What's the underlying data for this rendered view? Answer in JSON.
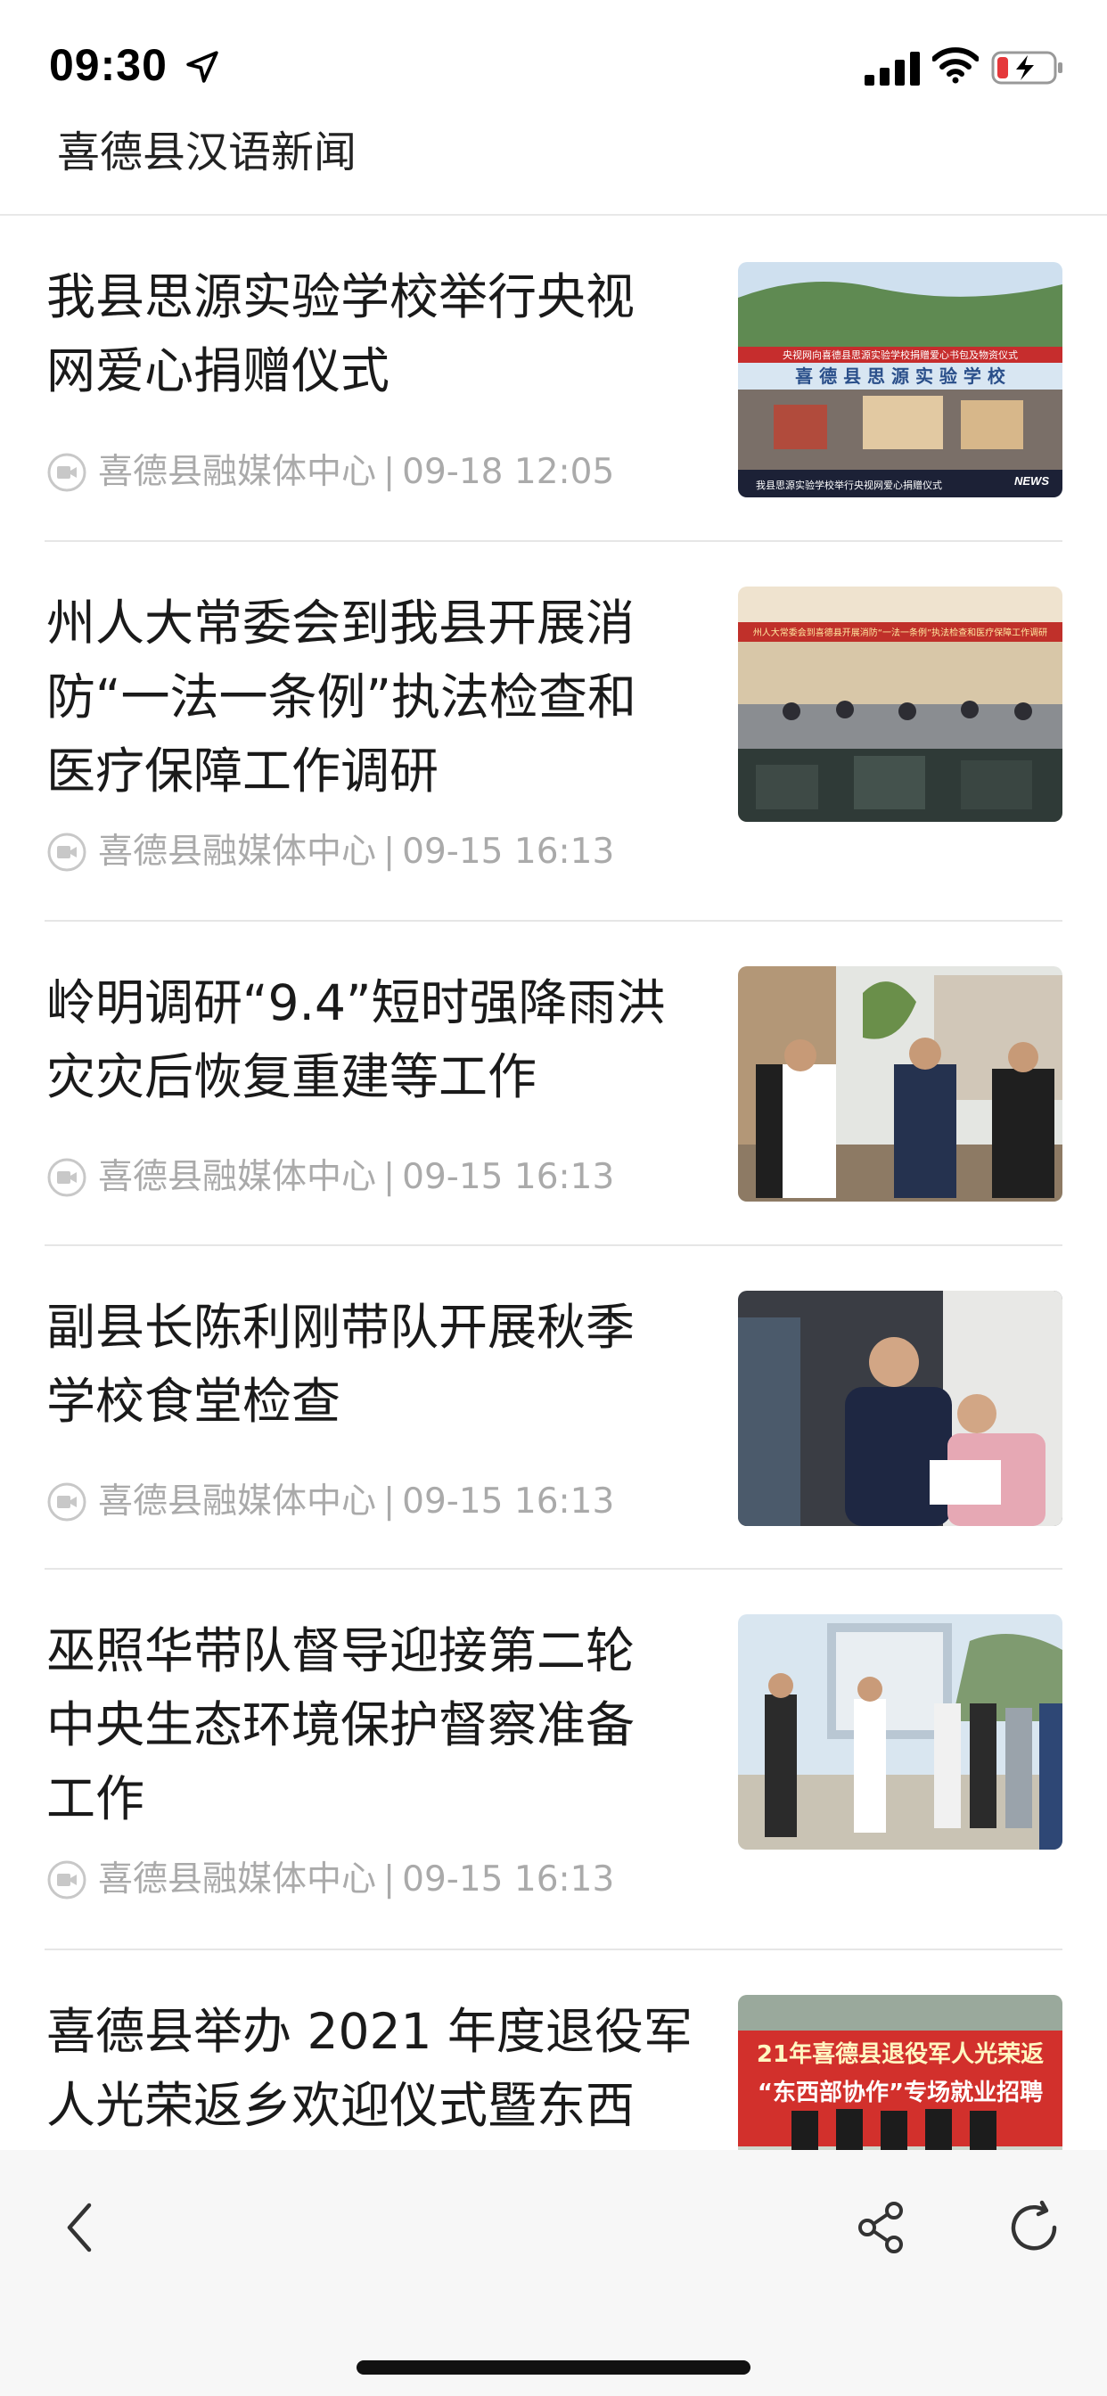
{
  "status_bar": {
    "time": "09:30",
    "icons": [
      "location-arrow-icon",
      "cellular-signal-icon",
      "wifi-icon",
      "battery-charging-icon"
    ],
    "battery_color": "#e5383b"
  },
  "header": {
    "title": "喜德县汉语新闻"
  },
  "news": [
    {
      "title_lines": [
        "我县思源实验学校举行央视",
        "网爱心捐赠仪式"
      ],
      "source": "喜德县融媒体中心",
      "separator": "|",
      "date": "09-18 12:05",
      "thumb": "school-donation-ceremony-photo",
      "thumb_caption": "我县思源实验学校举行央视网爱心捐赠仪式"
    },
    {
      "title_lines": [
        "州人大常委会到我县开展消",
        "防“一法一条例”执法检查和",
        "医疗保障工作调研"
      ],
      "source": "喜德县融媒体中心",
      "separator": "|",
      "date": "09-15 16:13",
      "thumb": "meeting-room-photo"
    },
    {
      "title_lines": [
        "岭明调研“9.4”短时强降雨洪",
        "灾灾后恢复重建等工作"
      ],
      "source": "喜德县融媒体中心",
      "separator": "|",
      "date": "09-15 16:13",
      "thumb": "field-inspection-photo"
    },
    {
      "title_lines": [
        "副县长陈利刚带队开展秋季",
        "学校食堂检查"
      ],
      "source": "喜德县融媒体中心",
      "separator": "|",
      "date": "09-15 16:13",
      "thumb": "canteen-inspection-photo"
    },
    {
      "title_lines": [
        "巫照华带队督导迎接第二轮",
        "中央生态环境保护督察准备",
        "工作"
      ],
      "source": "喜德县融媒体中心",
      "separator": "|",
      "date": "09-15 16:13",
      "thumb": "environmental-inspection-photo"
    },
    {
      "title_lines": [
        "喜德县举办 2021 年度退役军",
        "人光荣返乡欢迎仪式暨东西"
      ],
      "source": "",
      "separator": "",
      "date": "",
      "thumb": "veterans-welcome-banner-photo"
    }
  ],
  "toolbar": {
    "back": "back-chevron-icon",
    "share": "share-icon",
    "refresh": "refresh-icon"
  },
  "colors": {
    "title_text": "#1a1a1a",
    "meta_text": "#aaaaaa",
    "divider": "#e6e6e6",
    "toolbar_bg": "#f7f7f7"
  }
}
